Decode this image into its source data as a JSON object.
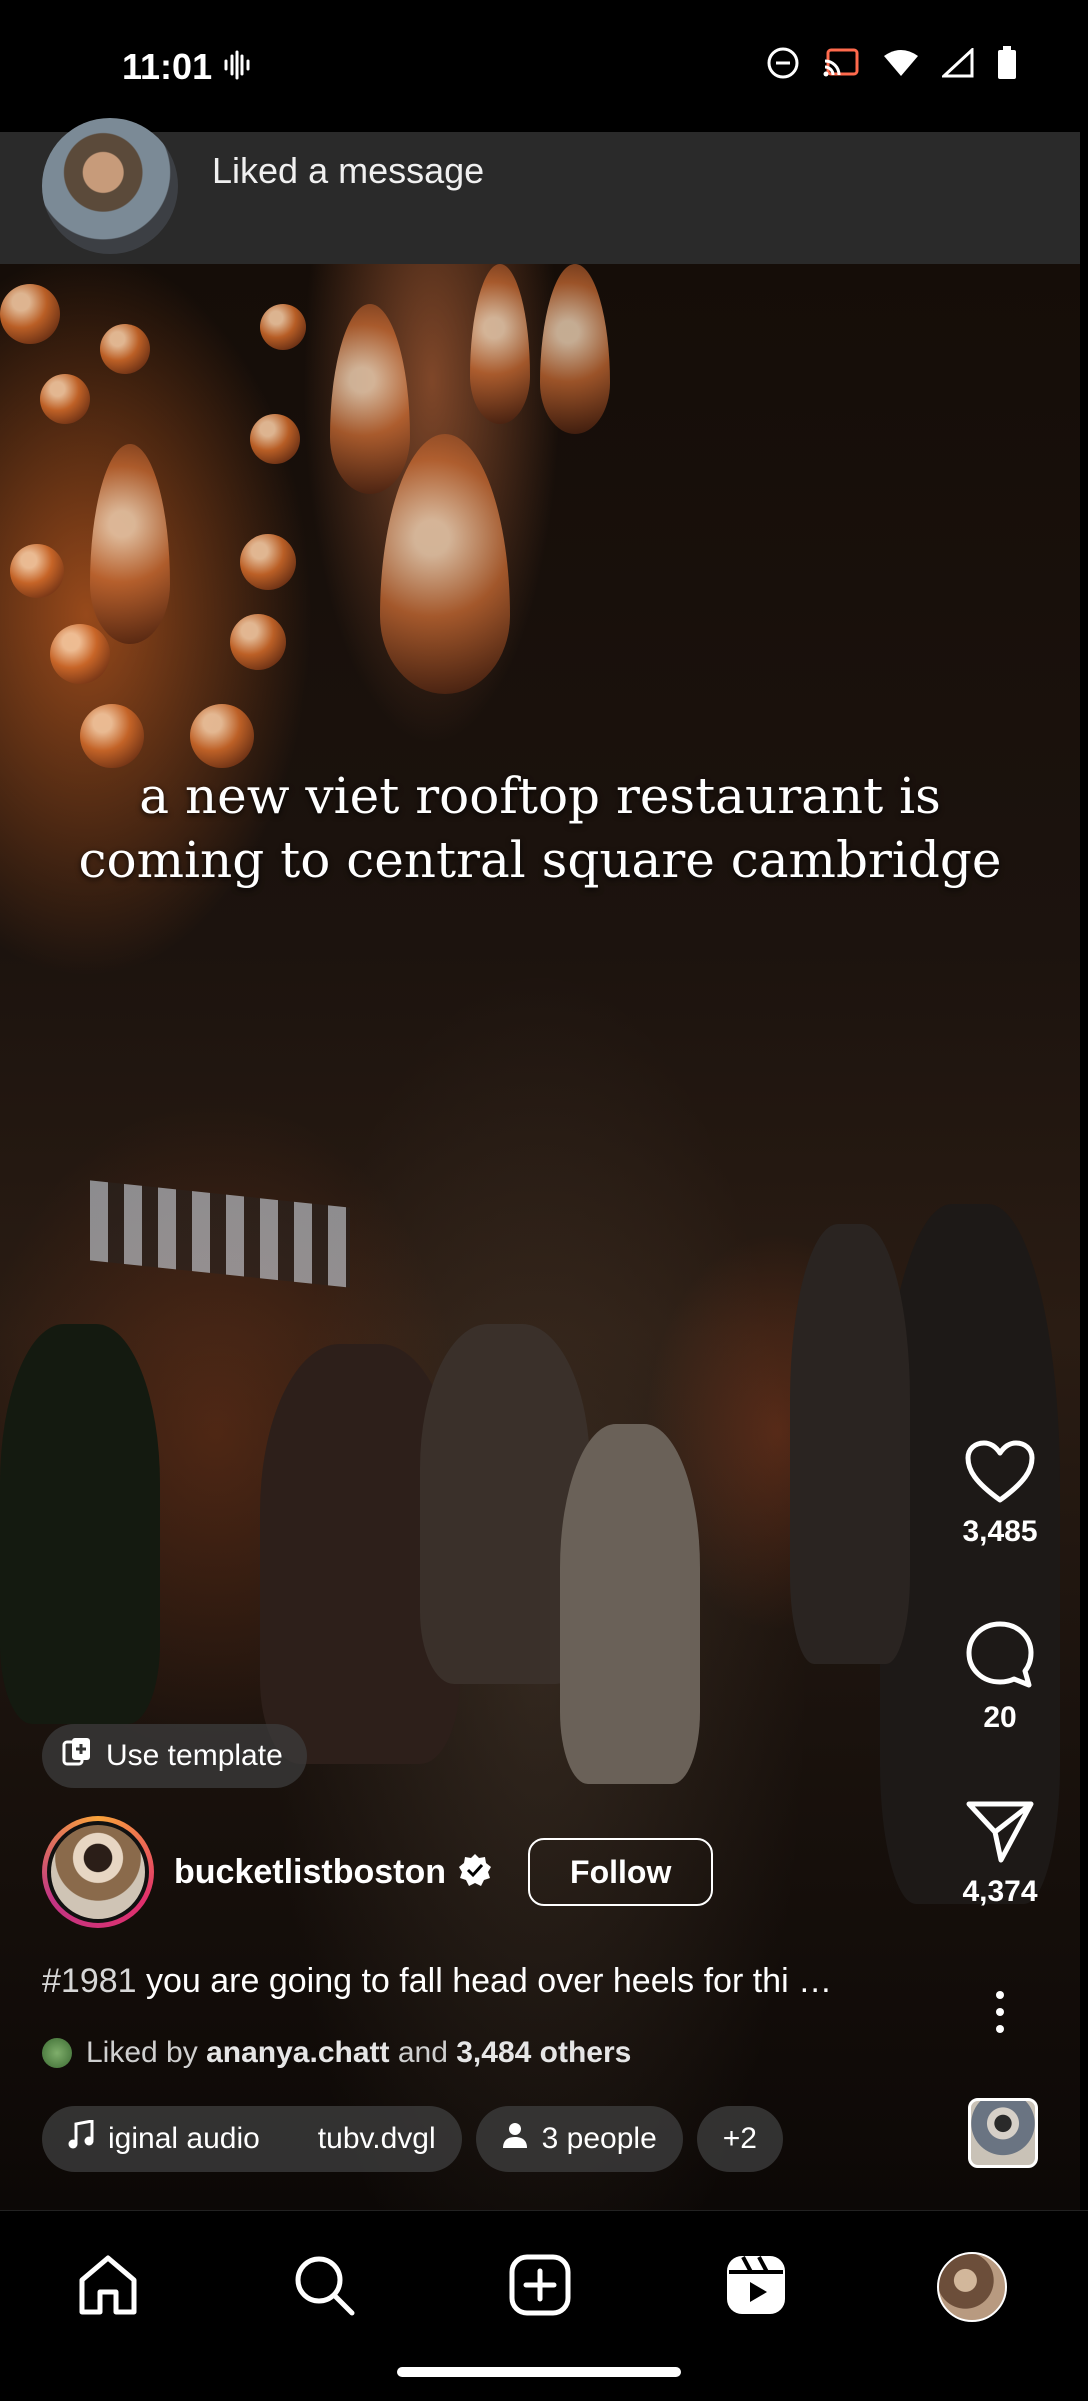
{
  "status_bar": {
    "time": "11:01",
    "icons": [
      "vibrate-icon",
      "do-not-disturb-icon",
      "cast-icon",
      "wifi-icon",
      "signal-icon",
      "battery-icon"
    ]
  },
  "notification": {
    "text": "Liked a message"
  },
  "reel": {
    "overlay_text_line1": "a new viet rooftop restaurant is",
    "overlay_text_line2": "coming to central square cambridge",
    "use_template_label": "Use template",
    "author": "bucketlistboston",
    "follow_label": "Follow",
    "caption_tag": "#1981",
    "caption_text": "you are going to fall head over heels for thi …",
    "liked_by_prefix": "Liked by",
    "liked_by_user": "ananya.chatt",
    "liked_by_and": "and",
    "liked_by_others": "3,484 others",
    "chips": {
      "audio_part1": "iginal audio",
      "audio_part2": "tubv.dvgl",
      "people": "3 people",
      "more": "+2"
    }
  },
  "actions": {
    "likes": "3,485",
    "comments": "20",
    "shares": "4,374"
  },
  "nav": {
    "items": [
      "home",
      "search",
      "create",
      "reels",
      "profile"
    ]
  },
  "colors": {
    "background": "#000000",
    "text": "#ffffff",
    "chip_bg": "#3c3c3c",
    "notification_bg": "#2a2a2a"
  }
}
